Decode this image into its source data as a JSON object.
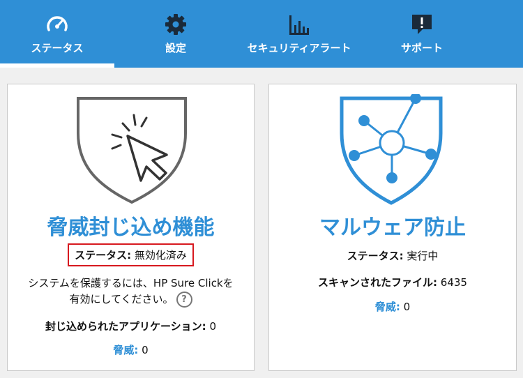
{
  "nav": {
    "tabs": [
      {
        "label": "ステータス",
        "icon": "speedometer-icon"
      },
      {
        "label": "設定",
        "icon": "gear-icon"
      },
      {
        "label": "セキュリティアラート",
        "icon": "bar-chart-icon"
      },
      {
        "label": "サポート",
        "icon": "alert-chat-icon"
      }
    ]
  },
  "containment": {
    "title": "脅威封じ込め機能",
    "status_label": "ステータス:",
    "status_value": "無効化済み",
    "description_line1": "システムを保護するには、HP Sure Clickを",
    "description_line2": "有効にしてください。",
    "help_glyph": "?",
    "contained_apps_label": "封じ込められたアプリケーション:",
    "contained_apps_value": "0",
    "threats_label": "脅威:",
    "threats_value": "0"
  },
  "malware": {
    "title": "マルウェア防止",
    "status_label": "ステータス:",
    "status_value": "実行中",
    "scanned_label": "スキャンされたファイル:",
    "scanned_value": "6435",
    "threats_label": "脅威:",
    "threats_value": "0"
  },
  "colors": {
    "accent": "#2f8fd6",
    "highlight_box": "#d7191f"
  }
}
